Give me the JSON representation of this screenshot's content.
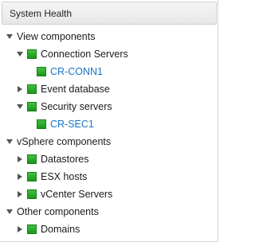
{
  "header": {
    "title": "System Health"
  },
  "colors": {
    "status_ok": "#22a822",
    "link": "#1a73c8"
  },
  "tree": {
    "view_components": {
      "label": "View components",
      "connection_servers": {
        "label": "Connection Servers",
        "child": "CR-CONN1"
      },
      "event_database": {
        "label": "Event database"
      },
      "security_servers": {
        "label": "Security servers",
        "child": "CR-SEC1"
      }
    },
    "vsphere_components": {
      "label": "vSphere components",
      "datastores": {
        "label": "Datastores"
      },
      "esx_hosts": {
        "label": "ESX hosts"
      },
      "vcenter_servers": {
        "label": "vCenter Servers"
      }
    },
    "other_components": {
      "label": "Other components",
      "domains": {
        "label": "Domains"
      }
    }
  }
}
